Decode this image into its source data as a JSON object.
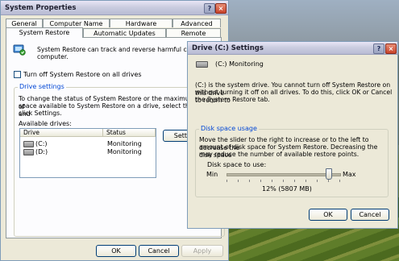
{
  "colors": {
    "xp_face": "#ece9d8",
    "group_title_blue": "#0046d5",
    "close_red": "#c8432a",
    "button_border": "#003c74"
  },
  "system_properties": {
    "title": "System Properties",
    "help_btn": "?",
    "close_btn": "×",
    "tabs_back": [
      "General",
      "Computer Name",
      "Hardware",
      "Advanced"
    ],
    "tabs_front": [
      "System Restore",
      "Automatic Updates",
      "Remote"
    ],
    "intro": "System Restore can track and reverse harmful changes to your computer.",
    "intro_visible": "System Restore can track and reverse harmful changes to",
    "intro_line2": "computer.",
    "turn_off_label": "Turn off System Restore on all drives",
    "turn_off_checked": false,
    "drive_settings_title": "Drive settings",
    "drive_settings_text1": "To change the status of System Restore or the maximum amount of",
    "drive_settings_text2": "space available to System Restore on a drive, select the drive, and",
    "drive_settings_text3": "click Settings.",
    "available_drives_label": "Available drives:",
    "columns": [
      "Drive",
      "Status"
    ],
    "drives": [
      {
        "drive": "(C:)",
        "status": "Monitoring"
      },
      {
        "drive": "(D:)",
        "status": "Monitoring"
      }
    ],
    "settings_btn": "Settings...",
    "ok": "OK",
    "cancel": "Cancel",
    "apply": "Apply"
  },
  "drive_dialog": {
    "title": "Drive (C:) Settings",
    "help_btn": "?",
    "close_btn": "×",
    "drive_status": "(C:)  Monitoring",
    "info_line1": "(C:) is the system drive. You cannot turn off System Restore on this drive",
    "info_line2": "without turning it off on all drives. To do this, click OK or Cancel to return to",
    "info_line3": "the System Restore tab.",
    "disk_usage_title": "Disk space usage",
    "usage_line1": "Move the slider to the right to increase or to the left to decrease the",
    "usage_line2": "amount of disk space for System Restore. Decreasing the disk space",
    "usage_line3": "may reduce the number of available restore points.",
    "disk_space_label": "Disk space to use:",
    "min_label": "Min",
    "max_label": "Max",
    "slider_percent": 12,
    "slider_position_fraction": 0.9,
    "value_label": "12% (5807 MB)",
    "ok": "OK",
    "cancel": "Cancel"
  }
}
